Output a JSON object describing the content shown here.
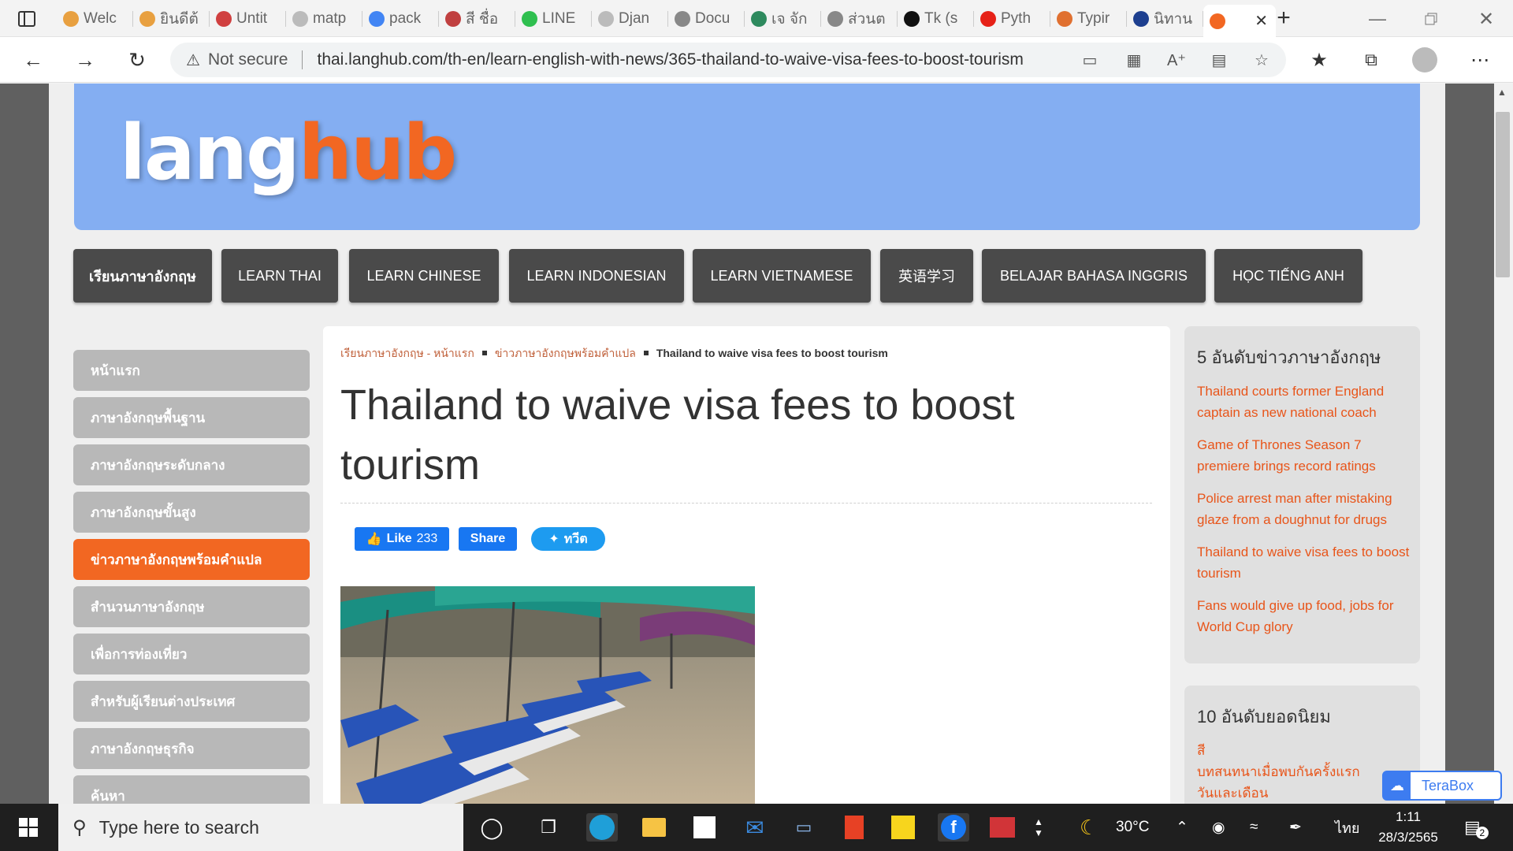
{
  "browser": {
    "tabs": [
      {
        "label": "Welc",
        "icon": "co-icon",
        "color": "#e8a040"
      },
      {
        "label": "ยินดีต้",
        "icon": "co-icon",
        "color": "#e8a040"
      },
      {
        "label": "Untit",
        "icon": "co-icon",
        "color": "#d04040"
      },
      {
        "label": "matp",
        "icon": "page-icon",
        "color": "#bbbbbb"
      },
      {
        "label": "pack",
        "icon": "google-icon",
        "color": "#4285f4"
      },
      {
        "label": "สี ชื่อ",
        "icon": "logo-icon",
        "color": "#c04040"
      },
      {
        "label": "LINE",
        "icon": "line-icon",
        "color": "#2fbf4f"
      },
      {
        "label": "Djan",
        "icon": "page-icon",
        "color": "#bbbbbb"
      },
      {
        "label": "Docu",
        "icon": "doc-icon",
        "color": "#888888"
      },
      {
        "label": "เจ จัก",
        "icon": "c-icon",
        "color": "#2e8a5e"
      },
      {
        "label": "ส่วนต",
        "icon": "wiki-icon",
        "color": "#888888"
      },
      {
        "label": "Tk (s",
        "icon": "wiki-icon",
        "color": "#111111"
      },
      {
        "label": "Pyth",
        "icon": "youtube-icon",
        "color": "#e62117"
      },
      {
        "label": "Typir",
        "icon": "circle-icon",
        "color": "#e07030"
      },
      {
        "label": "นิทาน",
        "icon": "flag-icon",
        "color": "#1d3f8f"
      },
      {
        "label": "",
        "icon": "langhub-icon",
        "color": "#f26722"
      }
    ],
    "url_warning": "Not secure",
    "url": "thai.langhub.com/th-en/learn-english-with-news/365-thailand-to-waive-visa-fees-to-boost-tourism"
  },
  "page": {
    "logo": {
      "part1": "lang",
      "part2": "hub"
    },
    "topnav": [
      "เรียนภาษาอังกฤษ",
      "LEARN THAI",
      "LEARN CHINESE",
      "LEARN INDONESIAN",
      "LEARN VIETNAMESE",
      "英语学习",
      "BELAJAR BAHASA INGGRIS",
      "HỌC TIẾNG ANH"
    ],
    "sidebar": [
      {
        "label": "หน้าแรก",
        "active": false
      },
      {
        "label": "ภาษาอังกฤษพื้นฐาน",
        "active": false
      },
      {
        "label": "ภาษาอังกฤษระดับกลาง",
        "active": false
      },
      {
        "label": "ภาษาอังกฤษขั้นสูง",
        "active": false
      },
      {
        "label": "ข่าวภาษาอังกฤษพร้อมคำแปล",
        "active": true
      },
      {
        "label": "สำนวนภาษาอังกฤษ",
        "active": false
      },
      {
        "label": "เพื่อการท่องเที่ยว",
        "active": false
      },
      {
        "label": "สำหรับผู้เรียนต่างประเทศ",
        "active": false
      },
      {
        "label": "ภาษาอังกฤษธุรกิจ",
        "active": false
      },
      {
        "label": "ค้นหา",
        "active": false
      }
    ],
    "breadcrumb": {
      "home": "เรียนภาษาอังกฤษ - หน้าแรก",
      "section": "ข่าวภาษาอังกฤษพร้อมคำแปล",
      "current": "Thailand to waive visa fees to boost tourism"
    },
    "article": {
      "title": "Thailand to waive visa fees to boost tourism",
      "like_label": "Like",
      "like_count": "233",
      "share_label": "Share",
      "tweet_label": "ทวีต"
    },
    "top5": {
      "heading": "5 อันดับข่าวภาษาอังกฤษ",
      "items": [
        "Thailand courts former England captain as new national coach",
        "Game of Thrones Season 7 premiere brings record ratings",
        "Police arrest man after mistaking glaze from a doughnut for drugs",
        "Thailand to waive visa fees to boost tourism",
        "Fans would give up food, jobs for World Cup glory"
      ]
    },
    "top10": {
      "heading": "10 อันดับยอดนิยม",
      "items": [
        "สี",
        "บทสนทนาเมื่อพบกันครั้งแรก",
        "วันและเดือน"
      ]
    },
    "terabox": "TeraBox"
  },
  "taskbar": {
    "search_placeholder": "Type here to search",
    "weather": "30°C",
    "language": "ไทย",
    "time": "1:11",
    "date": "28/3/2565",
    "notifications": "2"
  }
}
